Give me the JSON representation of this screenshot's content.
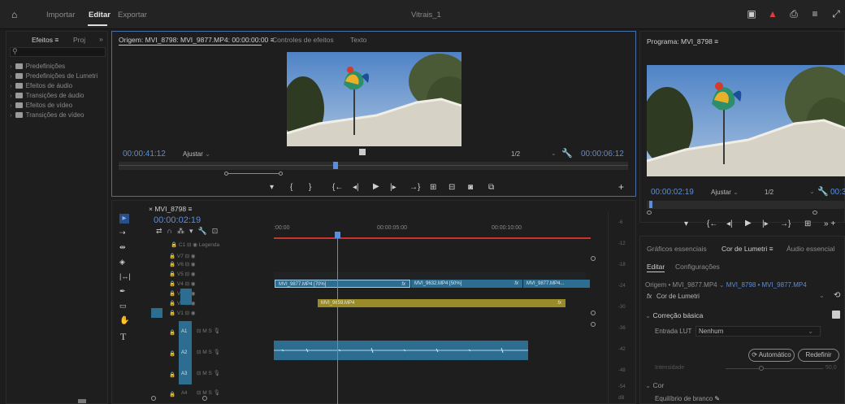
{
  "topbar": {
    "tabs": [
      "Importar",
      "Editar",
      "Exportar"
    ],
    "active_tab": "Editar",
    "project_title": "Vitrais_1"
  },
  "effects_panel": {
    "tabs": [
      "Efeitos",
      "Proj"
    ],
    "more": "»",
    "search_placeholder": "",
    "items": [
      "Predefinições",
      "Predefinições de Lumetri",
      "Efeitos de áudio",
      "Transições de áudio",
      "Efeitos de vídeo",
      "Transições de vídeo"
    ]
  },
  "source_monitor": {
    "tabs": [
      "Origem: MVI_8798: MVI_9877.MP4: 00:00:00:00",
      "Controles de efeitos",
      "Texto"
    ],
    "timecode_left": "00:00:41:12",
    "fit": "Ajustar",
    "resolution": "1/2",
    "timecode_right": "00:00:06:12"
  },
  "program_monitor": {
    "title": "Programa: MVI_8798",
    "timecode_left": "00:00:02:19",
    "fit": "Ajustar",
    "resolution": "1/2",
    "timecode_right": "00:3"
  },
  "timeline": {
    "sequence_tab": "MVI_8798",
    "timecode": "00:00:02:19",
    "ruler": [
      ":00:00",
      "00:00:05:00",
      "00:00:10:00"
    ],
    "caption_track": "Legenda",
    "video_tracks": [
      "V7",
      "V6",
      "V5",
      "V4",
      "V3",
      "V2",
      "V1"
    ],
    "audio_tracks": [
      "A1",
      "A2",
      "A3",
      "A4"
    ],
    "clips_v4": [
      "MVI_9877.MP4 [70%]",
      "MVI_9632.MP4 [50%]",
      "MVI_9877.MP4..."
    ],
    "clip_v2": "MVI_9659.MP4",
    "fx": "fx",
    "audio_meter_labels": [
      "-6",
      "-12",
      "-18",
      "-24",
      "-30",
      "-36",
      "-42",
      "-48",
      "-54",
      "dB"
    ],
    "track_buttons": {
      "m": "M",
      "s": "S"
    }
  },
  "lumetri_panel": {
    "tabs": [
      "Gráficos essenciais",
      "Cor de Lumetri",
      "Áudio essencial"
    ],
    "subtabs": [
      "Editar",
      "Configurações"
    ],
    "source_line_a": "Origem • MVI_9877.MP4",
    "source_line_b": "MVI_8798 • MVI_9877.MP4",
    "effect": "Cor de Lumetri",
    "fx": "fx",
    "section_basic": "Correção básica",
    "lut_label": "Entrada LUT",
    "lut_value": "Nenhum",
    "btn_auto": "Automático",
    "btn_reset": "Redefinir",
    "intensity_label": "Intensidade",
    "intensity_value": "50,0",
    "section_color": "Cor",
    "wb_label": "Equilíbrio de branco"
  },
  "colors": {
    "accent_blue": "#5b8ddb",
    "clip_blue": "#2c6d90",
    "clip_yellow": "#998a2a",
    "playhead_red": "#c8332d"
  }
}
